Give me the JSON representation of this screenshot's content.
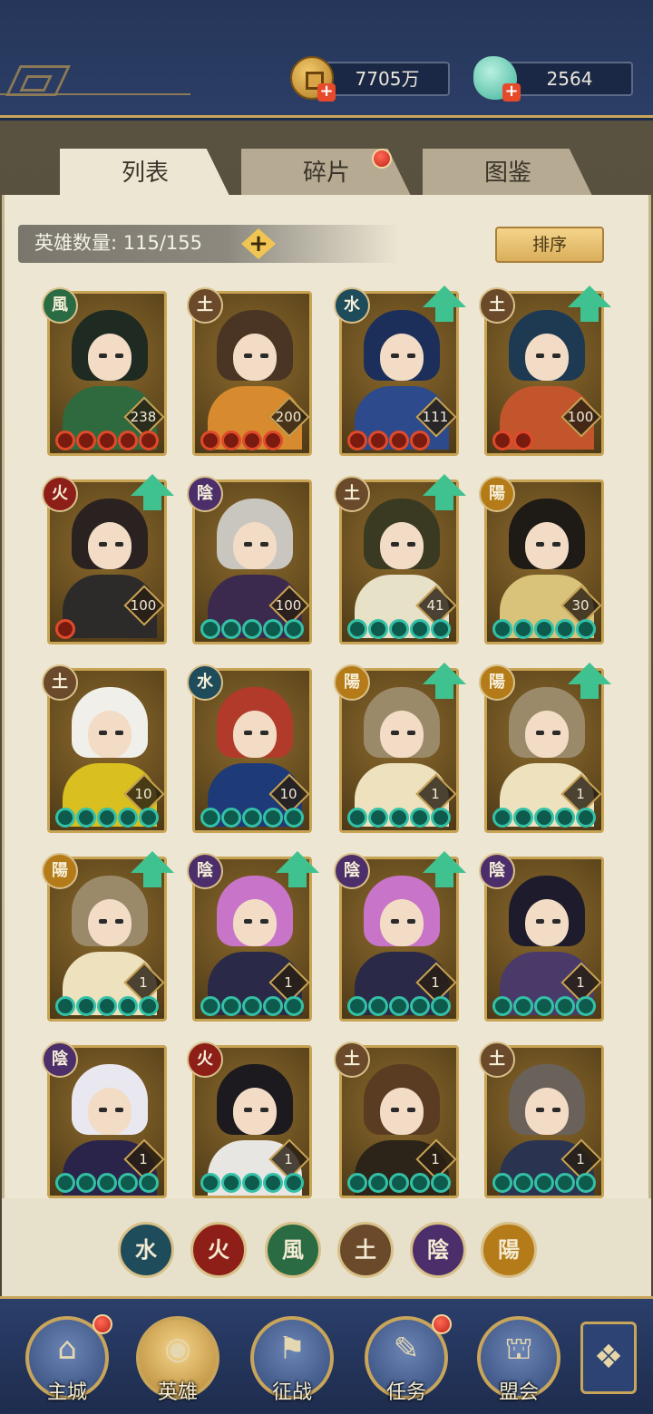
{
  "currency": {
    "coins": "7705万",
    "jade": "2564"
  },
  "tabs": [
    "列表",
    "碎片",
    "图鉴"
  ],
  "hero_count": "英雄数量: 115/155",
  "sort_label": "排序",
  "heroes": [
    {
      "element": "風",
      "level": "238",
      "stars": 5,
      "star_color": "red",
      "upgrade": false
    },
    {
      "element": "土",
      "level": "200",
      "stars": 4,
      "star_color": "red",
      "upgrade": false
    },
    {
      "element": "水",
      "level": "111",
      "stars": 4,
      "star_color": "red",
      "upgrade": true
    },
    {
      "element": "土",
      "level": "100",
      "stars": 2,
      "star_color": "red",
      "upgrade": true
    },
    {
      "element": "火",
      "level": "100",
      "stars": 1,
      "star_color": "red",
      "upgrade": true
    },
    {
      "element": "陰",
      "level": "100",
      "stars": 5,
      "star_color": "jade",
      "upgrade": false
    },
    {
      "element": "土",
      "level": "41",
      "stars": 5,
      "star_color": "jade",
      "upgrade": true
    },
    {
      "element": "陽",
      "level": "30",
      "stars": 5,
      "star_color": "jade",
      "upgrade": false
    },
    {
      "element": "土",
      "level": "10",
      "stars": 5,
      "star_color": "jade",
      "upgrade": false
    },
    {
      "element": "水",
      "level": "10",
      "stars": 5,
      "star_color": "jade",
      "upgrade": false
    },
    {
      "element": "陽",
      "level": "1",
      "stars": 5,
      "star_color": "jade",
      "upgrade": true
    },
    {
      "element": "陽",
      "level": "1",
      "stars": 5,
      "star_color": "jade",
      "upgrade": true
    },
    {
      "element": "陽",
      "level": "1",
      "stars": 5,
      "star_color": "jade",
      "upgrade": true
    },
    {
      "element": "陰",
      "level": "1",
      "stars": 5,
      "star_color": "jade",
      "upgrade": true
    },
    {
      "element": "陰",
      "level": "1",
      "stars": 5,
      "star_color": "jade",
      "upgrade": true
    },
    {
      "element": "陰",
      "level": "1",
      "stars": 5,
      "star_color": "jade",
      "upgrade": false
    },
    {
      "element": "陰",
      "level": "1",
      "stars": 5,
      "star_color": "jade",
      "upgrade": false
    },
    {
      "element": "火",
      "level": "1",
      "stars": 5,
      "star_color": "jade",
      "upgrade": false
    },
    {
      "element": "土",
      "level": "1",
      "stars": 5,
      "star_color": "jade",
      "upgrade": false
    },
    {
      "element": "土",
      "level": "1",
      "stars": 5,
      "star_color": "jade",
      "upgrade": false
    }
  ],
  "filters": [
    "水",
    "火",
    "風",
    "土",
    "陰",
    "陽"
  ],
  "nav": [
    {
      "label": "主城",
      "dot": true
    },
    {
      "label": "英雄",
      "dot": false,
      "active": true
    },
    {
      "label": "征战",
      "dot": false
    },
    {
      "label": "任务",
      "dot": true
    },
    {
      "label": "盟会",
      "dot": false
    }
  ],
  "colors": {
    "accent_gold": "#c9a55a",
    "panel_bg": "#ece6d2",
    "nav_bg": "#2b3f6b",
    "notify_red": "#e04a2a",
    "upgrade_green": "#40c290"
  }
}
